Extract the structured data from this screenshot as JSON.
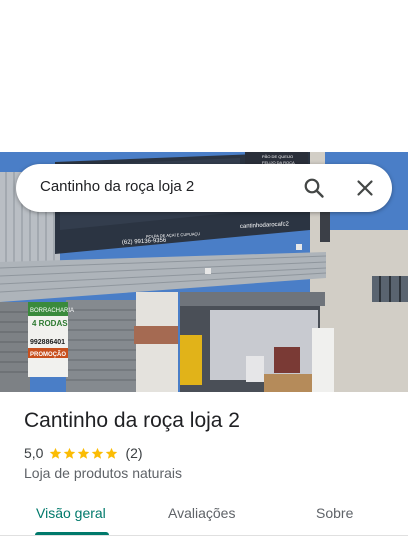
{
  "search": {
    "query": "Cantinho da roça loja 2"
  },
  "place": {
    "name": "Cantinho da roça loja 2",
    "rating": "5,0",
    "stars": 5,
    "review_count": "(2)",
    "category": "Loja de produtos naturais"
  },
  "photo": {
    "sign_phone": "(62) 99136-9356",
    "sign_handle": "cantinhodarocafc2",
    "sign_subtitle": "POLPA DE AÇAÍ E CUPUAÇU",
    "sign_side_line1": "PÃO DE QUEIJO",
    "sign_side_line2": "FELIJO DA ROÇA",
    "sign_side_line3": "DOCE RALADO",
    "banner_line1": "BORRACHARIA",
    "banner_line2": "4 RODAS",
    "banner_phone": "992886401",
    "banner_promo": "PROMOÇÃO"
  },
  "tabs": [
    {
      "label": "Visão geral",
      "selected": true
    },
    {
      "label": "Avaliações",
      "selected": false
    },
    {
      "label": "Sobre",
      "selected": false
    }
  ],
  "colors": {
    "accent": "#00796b",
    "star": "#fbbc04",
    "text_primary": "#202124",
    "text_secondary": "#5f6368"
  },
  "icons": {
    "search": "search-icon",
    "close": "close-icon",
    "star": "star-icon"
  }
}
